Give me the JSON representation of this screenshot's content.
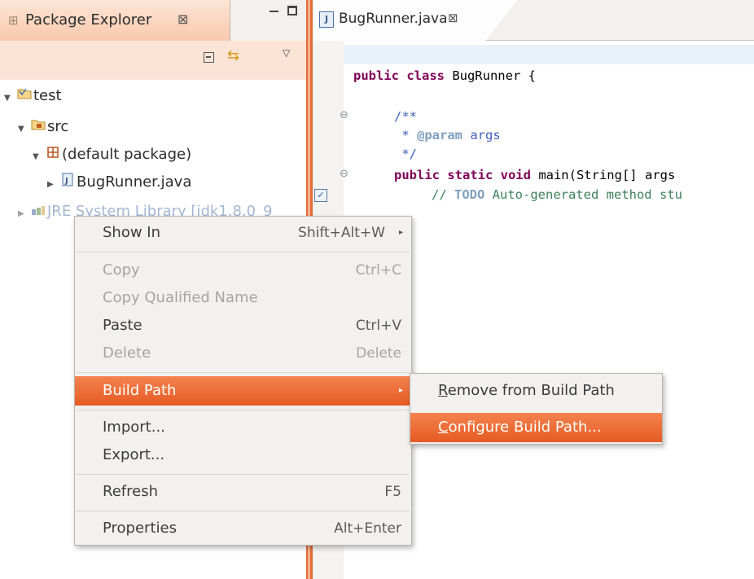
{
  "package_explorer": {
    "tab_label": "Package Explorer",
    "close_glyph": "⊠",
    "tree": [
      {
        "label": "test",
        "twisty": "▼",
        "icon": "project-icon"
      },
      {
        "label": "src",
        "twisty": "▼",
        "icon": "source-folder-icon"
      },
      {
        "label": "(default package)",
        "twisty": "▼",
        "icon": "package-icon"
      },
      {
        "label": "BugRunner.java",
        "twisty": "▶",
        "icon": "java-file-icon"
      },
      {
        "label": "JRE System Library [jdk1.8.0_9",
        "twisty": "▶",
        "icon": "library-icon"
      }
    ]
  },
  "editor": {
    "tab_label": "BugRunner.java",
    "close_glyph": "⊠",
    "code": {
      "class_kw": "public class",
      "class_rest": " BugRunner {",
      "jdoc_open": "/**",
      "jdoc_star": " * ",
      "jdoc_tag": "@param",
      "jdoc_tag_rest": " args",
      "jdoc_close": " */",
      "main_kw": "public static void",
      "main_rest": " main(String[] args",
      "todo_prefix": "// ",
      "todo_tag": "TODO",
      "todo_rest": " Auto-generated method stu"
    }
  },
  "context_menu": {
    "items": [
      {
        "label": "Show In",
        "accel": "Shift+Alt+W",
        "submenu": true,
        "enabled": true
      },
      {
        "label": "Copy",
        "accel": "Ctrl+C",
        "enabled": false
      },
      {
        "label": "Copy Qualified Name",
        "accel": "",
        "enabled": false
      },
      {
        "label": "Paste",
        "accel": "Ctrl+V",
        "enabled": true
      },
      {
        "label": "Delete",
        "accel": "Delete",
        "enabled": false
      },
      {
        "label": "Build Path",
        "accel": "",
        "submenu": true,
        "enabled": true,
        "highlighted": true
      },
      {
        "label": "Import...",
        "accel": "",
        "enabled": true
      },
      {
        "label": "Export...",
        "accel": "",
        "enabled": true
      },
      {
        "label": "Refresh",
        "accel": "F5",
        "enabled": true
      },
      {
        "label": "Properties",
        "accel": "Alt+Enter",
        "enabled": true
      }
    ]
  },
  "submenu": {
    "items": [
      {
        "mnemonic": "R",
        "rest": "emove from Build Path"
      },
      {
        "mnemonic": "C",
        "rest": "onfigure Build Path...",
        "highlighted": true
      }
    ]
  },
  "colors": {
    "highlight": "#e65a23",
    "active_tab": "#f8c9ac",
    "keyword": "#7f0055",
    "comment": "#3f7f5f",
    "javadoc": "#3f5fbf"
  }
}
